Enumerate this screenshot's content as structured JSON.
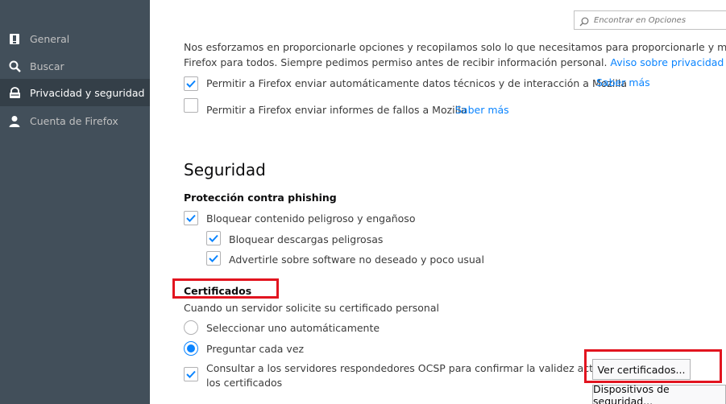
{
  "sidebar": {
    "items": [
      {
        "label": "General",
        "icon": "general-icon",
        "active": false
      },
      {
        "label": "Buscar",
        "icon": "search-icon",
        "active": false
      },
      {
        "label": "Privacidad y seguridad",
        "icon": "lock-icon",
        "active": true
      },
      {
        "label": "Cuenta de Firefox",
        "icon": "account-icon",
        "active": false
      }
    ]
  },
  "search": {
    "placeholder": "Encontrar en Opciones"
  },
  "privacy": {
    "intro_line1": "Nos esforzamos en proporcionarle opciones y recopilamos solo lo que necesitamos para proporcionarle y mejorar",
    "intro_line2": "Firefox para todos. Siempre pedimos permiso antes de recibir información personal.",
    "privacy_link": "Aviso sobre privacidad",
    "telemetry": {
      "label": "Permitir a Firefox enviar automáticamente datos técnicos y de interacción a Mozilla",
      "link": "Saber más",
      "checked": true
    },
    "crash": {
      "label": "Permitir a Firefox enviar informes de fallos a Mozilla",
      "link": "Saber más",
      "checked": false
    }
  },
  "security": {
    "title": "Seguridad",
    "phishing": {
      "heading": "Protección contra phishing",
      "block_content": {
        "label": "Bloquear contenido peligroso y engañoso",
        "checked": true
      },
      "block_downloads": {
        "label": "Bloquear descargas peligrosas",
        "checked": true
      },
      "warn_unwanted": {
        "label": "Advertirle sobre software no deseado y poco usual",
        "checked": true
      }
    },
    "certificates": {
      "heading": "Certificados",
      "description": "Cuando un servidor solicite su certificado personal",
      "radio_auto": {
        "label": "Seleccionar uno automáticamente",
        "selected": false
      },
      "radio_ask": {
        "label": "Preguntar cada vez",
        "selected": true
      },
      "ocsp": {
        "label_line1": "Consultar a los servidores respondedores OCSP para confirmar la validez actual de",
        "label_line2": "los certificados",
        "checked": true
      },
      "view_button": "Ver certificados...",
      "devices_button": "Dispositivos de seguridad..."
    }
  },
  "colors": {
    "highlight_box": "#e2141f",
    "accent": "#0a84ff",
    "sidebar_bg": "#424f5a"
  }
}
